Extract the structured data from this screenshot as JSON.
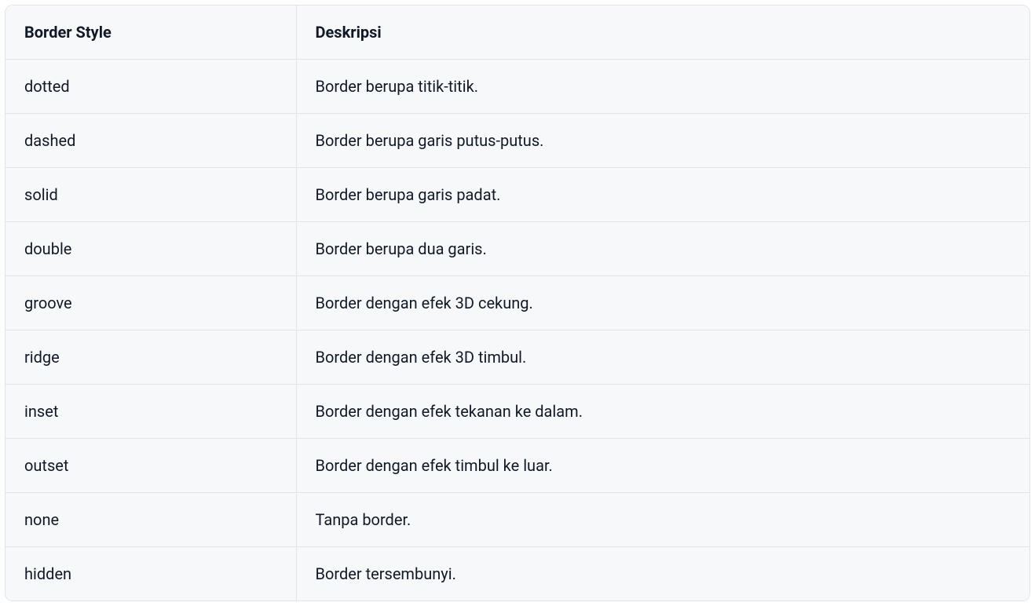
{
  "table": {
    "headers": {
      "col0": "Border Style",
      "col1": "Deskripsi"
    },
    "rows": [
      {
        "col0": "dotted",
        "col1": "Border berupa titik-titik."
      },
      {
        "col0": "dashed",
        "col1": "Border berupa garis putus-putus."
      },
      {
        "col0": "solid",
        "col1": "Border berupa garis padat."
      },
      {
        "col0": "double",
        "col1": "Border berupa dua garis."
      },
      {
        "col0": "groove",
        "col1": "Border dengan efek 3D cekung."
      },
      {
        "col0": "ridge",
        "col1": "Border dengan efek 3D timbul."
      },
      {
        "col0": "inset",
        "col1": "Border dengan efek tekanan ke dalam."
      },
      {
        "col0": "outset",
        "col1": "Border dengan efek timbul ke luar."
      },
      {
        "col0": "none",
        "col1": "Tanpa border."
      },
      {
        "col0": "hidden",
        "col1": "Border tersembunyi."
      }
    ]
  }
}
